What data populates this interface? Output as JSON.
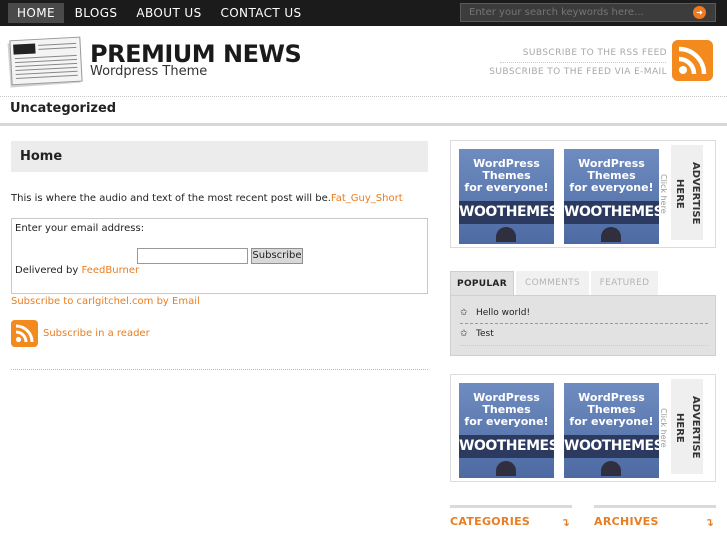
{
  "nav": {
    "items": [
      "HOME",
      "BLOGS",
      "ABOUT US",
      "CONTACT US"
    ],
    "search_placeholder": "Enter your search keywords here..."
  },
  "header": {
    "logo_title": "PREMIUM NEWS",
    "logo_subtitle": "Wordpress Theme",
    "rss_feed": "SUBSCRIBE TO THE RSS FEED",
    "rss_email": "SUBSCRIBE TO THE FEED VIA E-MAIL"
  },
  "category_bar": "Uncategorized",
  "main": {
    "title": "Home",
    "intro_text": "This is where the audio and text of the most recent post will be.",
    "intro_link": "Fat_Guy_Short",
    "email_label": "Enter your email address:",
    "subscribe_button": "Subscribe",
    "delivered_by": "Delivered by",
    "feedburner": "FeedBurner",
    "subscribe_email": "Subscribe to carlgitchel.com by Email",
    "subscribe_reader": "Subscribe in a reader"
  },
  "sidebar": {
    "ad_line1": "WordPress",
    "ad_line2": "Themes",
    "ad_line3": "for everyone!",
    "ad_brand": "WOOTHEMES",
    "advertise": "ADVERTISE HERE",
    "click_here": "Click here",
    "tabs": [
      "POPULAR",
      "COMMENTS",
      "FEATURED"
    ],
    "popular_items": [
      "Hello world!",
      "Test"
    ],
    "widgets": [
      "CATEGORIES",
      "ARCHIVES"
    ]
  },
  "colors": {
    "accent": "#e97d1f",
    "nav_bg": "#1b1b1b"
  }
}
